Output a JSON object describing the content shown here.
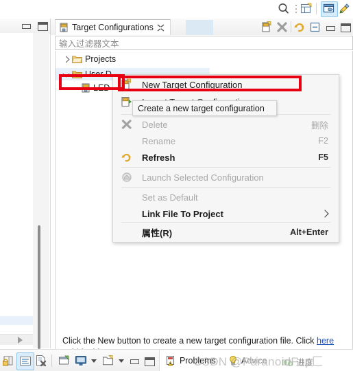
{
  "app": {
    "global_toolbar": {
      "icons": [
        {
          "name": "search-icon",
          "label": "Search"
        },
        {
          "name": "handle-dots-icon",
          "label": "Toolbar handle"
        },
        {
          "name": "new-perspective-icon",
          "label": "Open Perspective"
        },
        {
          "name": "perspective-debug-icon",
          "label": "Debug Perspective",
          "selected": true
        },
        {
          "name": "perspective-ccs-edit-icon",
          "label": "CCS Edit Perspective"
        }
      ]
    }
  },
  "left_view": {
    "minimize_label": "Minimize",
    "maximize_label": "Maximize",
    "scroll_right_label": "Scroll right"
  },
  "view": {
    "tab": {
      "label": "Target Configurations",
      "icon": "target-configuration-icon",
      "close_label": "Close"
    },
    "toolbar": [
      {
        "name": "new-target-configuration-icon",
        "label": "New Target Configuration"
      },
      {
        "name": "delete-icon",
        "label": "Delete"
      },
      {
        "name": "refresh-icon",
        "label": "Refresh"
      },
      {
        "name": "collapse-all-icon",
        "label": "Collapse All"
      },
      {
        "name": "minimize-icon",
        "label": "Minimize"
      },
      {
        "name": "maximize-icon",
        "label": "Maximize"
      }
    ],
    "filter": {
      "placeholder": "输入过滤器文本",
      "value": ""
    },
    "tree": [
      {
        "label": "Projects",
        "icon": "folder-icon",
        "expanded": false,
        "level": 0
      },
      {
        "label": "User D",
        "icon": "folder-open-icon",
        "expanded": true,
        "level": 0,
        "selected": true
      },
      {
        "label": "LED",
        "icon": "target-configuration-icon",
        "level": 1
      }
    ],
    "message": {
      "line1_before": "Click the New button to create a new target configuration file. Click ",
      "link": "here",
      "line2": "to hide this message."
    }
  },
  "context_menu": {
    "items": [
      {
        "label": "New Target Configuration",
        "icon": "new-target-configuration-icon",
        "accel": "",
        "enabled": true,
        "bold": false,
        "highlighted": true
      },
      {
        "label": "Import Target Configuration",
        "icon": "import-target-configuration-icon",
        "accel": "",
        "enabled": true,
        "bold": false
      },
      {
        "label": "Delete",
        "icon": "delete-x-icon",
        "accel": "删除",
        "enabled": false,
        "bold": false
      },
      {
        "label": "Rename",
        "icon": "",
        "accel": "F2",
        "enabled": false,
        "bold": false
      },
      {
        "label": "Refresh",
        "icon": "refresh-icon",
        "accel": "F5",
        "enabled": true,
        "bold": true
      },
      {
        "label": "Launch Selected Configuration",
        "icon": "launch-icon",
        "accel": "",
        "enabled": false,
        "bold": false
      },
      {
        "label": "Set as Default",
        "icon": "",
        "accel": "",
        "enabled": false,
        "bold": false
      },
      {
        "label": "Link File To Project",
        "icon": "",
        "accel": "",
        "enabled": true,
        "bold": true,
        "submenu": true
      },
      {
        "label": "属性(R)",
        "icon": "",
        "accel": "Alt+Enter",
        "enabled": true,
        "bold": true
      }
    ],
    "tooltip": "Create a new target configuration"
  },
  "annotations": {
    "highlight_color": "#e60012",
    "boxes": [
      {
        "name": "tree-item-highlight",
        "target": "User D tree item"
      },
      {
        "name": "menu-item-highlight",
        "target": "New Target Configuration menu item"
      }
    ]
  },
  "bottom_bar": {
    "left_icons": [
      {
        "name": "secure-storage-icon",
        "label": "Secure Storage"
      },
      {
        "name": "show-console-icon",
        "label": "Show Console",
        "selected": true
      },
      {
        "name": "clear-console-icon",
        "label": "Clear Console"
      },
      {
        "name": "new-target-config-icon",
        "label": "New Target Configuration"
      },
      {
        "name": "console-display-icon",
        "label": "Display Selected Console"
      },
      {
        "name": "open-console-icon",
        "label": "Open Console"
      },
      {
        "name": "minimize-icon",
        "label": "Minimize"
      },
      {
        "name": "maximize-icon",
        "label": "Maximize"
      }
    ],
    "tabs": [
      {
        "name": "tab-problems",
        "label": "Problems",
        "icon": "problems-icon"
      },
      {
        "name": "tab-advice",
        "label": "Advice",
        "icon": "advice-lightbulb-icon"
      },
      {
        "name": "tab-progress",
        "label": "进度",
        "icon": "progress-icon"
      }
    ],
    "watermark": "CSDN @ParanoidFup匚"
  }
}
